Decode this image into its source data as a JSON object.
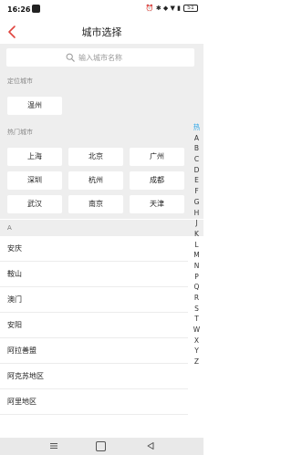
{
  "status_bar": {
    "time": "16:26",
    "icons": "⏰ ✱ ◆ ▼ ▮",
    "battery": "51"
  },
  "header": {
    "title": "城市选择"
  },
  "search": {
    "placeholder": "输入城市名称",
    "value": ""
  },
  "location": {
    "label": "定位城市",
    "city": "温州"
  },
  "hot": {
    "label": "热门城市",
    "cities": [
      "上海",
      "北京",
      "广州",
      "深圳",
      "杭州",
      "成都",
      "武汉",
      "南京",
      "天津"
    ]
  },
  "list": {
    "letter": "A",
    "cities": [
      "安庆",
      "鞍山",
      "澳门",
      "安阳",
      "阿拉善盟",
      "阿克苏地区",
      "阿里地区"
    ]
  },
  "index": {
    "hot_label": "热",
    "letters": [
      "A",
      "B",
      "C",
      "D",
      "E",
      "F",
      "G",
      "H",
      "J",
      "K",
      "L",
      "M",
      "N",
      "P",
      "Q",
      "R",
      "S",
      "T",
      "W",
      "X",
      "Y",
      "Z"
    ]
  },
  "colors": {
    "accent": "#e0443e",
    "index_hot": "#2aa5e8",
    "section_bg": "#eeeeee"
  }
}
